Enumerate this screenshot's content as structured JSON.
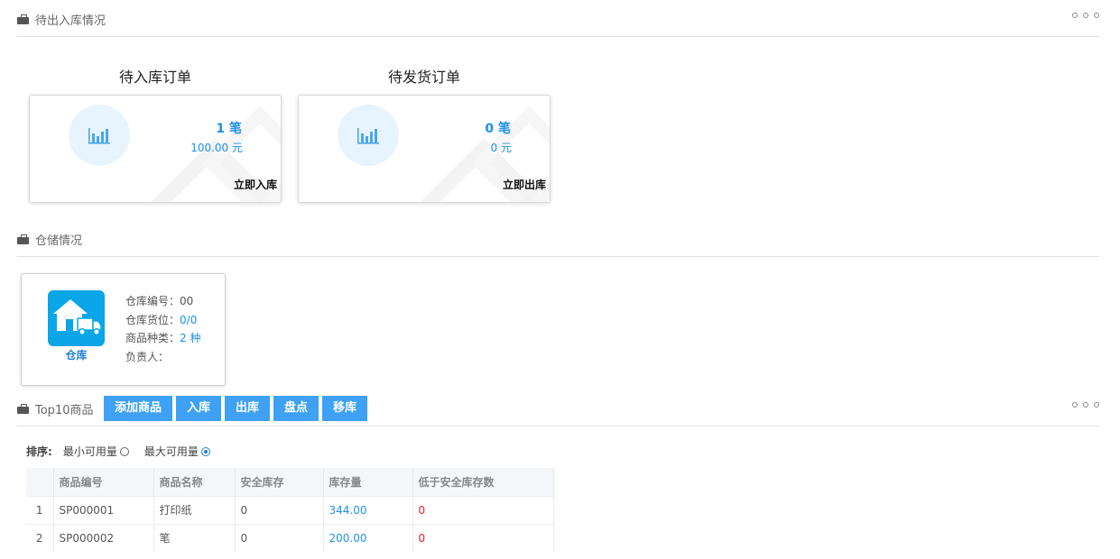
{
  "sections": {
    "pending": {
      "title": "待出入库情况"
    },
    "storage": {
      "title": "仓储情况"
    },
    "top10": {
      "title": "Top10商品"
    }
  },
  "orders": [
    {
      "title": "待入库订单",
      "count": "1 笔",
      "amount": "100.00 元",
      "action": "立即入库"
    },
    {
      "title": "待发货订单",
      "count": "0 笔",
      "amount": "0 元",
      "action": "立即出库"
    }
  ],
  "warehouse": {
    "label": "仓库",
    "code_label": "仓库编号：",
    "code_value": "00",
    "slot_label": "仓库货位：",
    "slot_value": "0/0",
    "types_label": "商品种类：",
    "types_value": "2 种",
    "owner_label": "负责人：",
    "owner_value": ""
  },
  "toolbar": {
    "add_label": "添加商品",
    "in_label": "入库",
    "out_label": "出库",
    "check_label": "盘点",
    "move_label": "移库"
  },
  "sort": {
    "label": "排序:",
    "option_min": "最小可用量",
    "option_max": "最大可用量",
    "selected": "最大可用量"
  },
  "table": {
    "headers": [
      "",
      "商品编号",
      "商品名称",
      "安全库存",
      "库存量",
      "低于安全库存数"
    ],
    "rows": [
      {
        "idx": "1",
        "code": "SP000001",
        "name": "打印纸",
        "safe": "0",
        "stock": "344.00",
        "below": "0"
      },
      {
        "idx": "2",
        "code": "SP000002",
        "name": "笔",
        "safe": "0",
        "stock": "200.00",
        "below": "0"
      }
    ]
  },
  "colors": {
    "accent": "#3ea1f3",
    "link": "#1e90e6",
    "warning": "#e82020",
    "warehouse_icon": "#0aa6e8"
  },
  "icons": {
    "section": "briefcase-icon",
    "order": "bar-chart-icon",
    "warehouse": "warehouse-truck-icon",
    "more": "more-dots-icon"
  }
}
